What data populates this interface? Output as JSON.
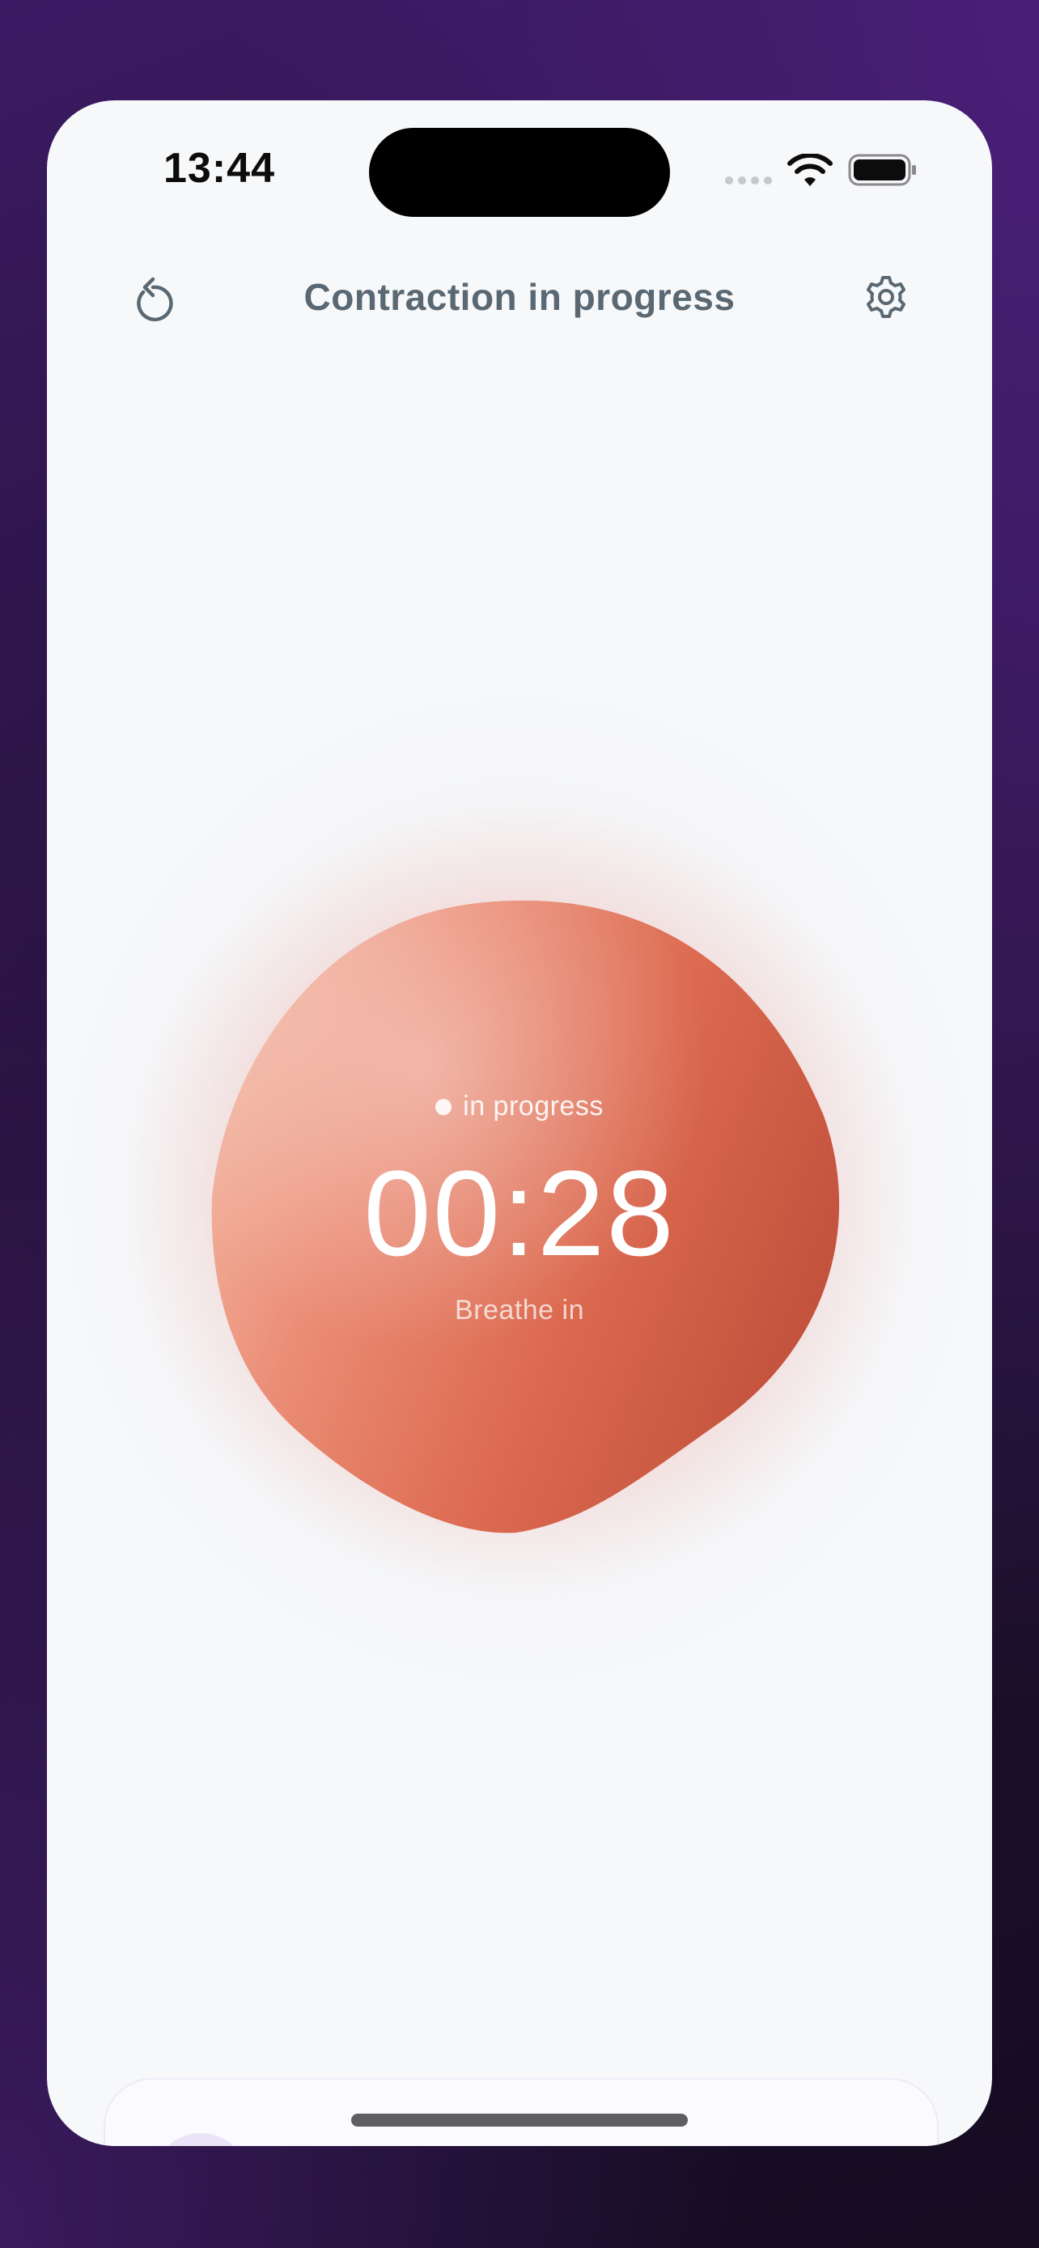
{
  "status_bar": {
    "time": "13:44"
  },
  "header": {
    "title": "Contraction in progress",
    "left_icon": "reset-icon",
    "right_icon": "gear-icon"
  },
  "timer": {
    "state_label": "in progress",
    "elapsed": "00:28",
    "breathing_cue": "Breathe in"
  },
  "colors": {
    "blob_light": "#f2b4a0",
    "blob_mid": "#e87a62",
    "blob_dark": "#c4533d",
    "title": "#596872",
    "background": "#f7f8fa"
  }
}
